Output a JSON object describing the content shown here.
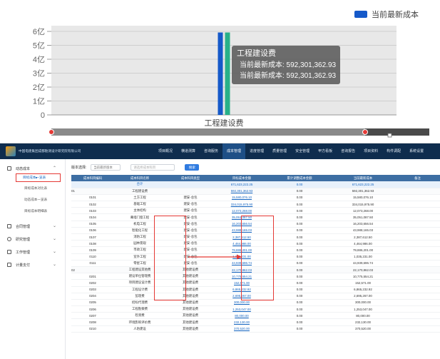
{
  "chart_data": {
    "type": "bar",
    "categories": [
      "工程建设费"
    ],
    "series": [
      {
        "name": "当前最新成本",
        "values": [
          5.92301362933
        ],
        "color": "#1559c9"
      },
      {
        "name": "当前最新成本",
        "values": [
          5.92301362933
        ],
        "color": "#27b089"
      }
    ],
    "ylim": [
      0,
      6
    ],
    "yticks": [
      "0",
      "1亿",
      "2亿",
      "3亿",
      "4亿",
      "5亿",
      "6亿"
    ],
    "legend": "top-right",
    "grid": true
  },
  "legend_label": "当前最新成本",
  "tooltip": {
    "title": "工程建设费",
    "rows": [
      {
        "label": "当前最新成本: 592,301,362.93",
        "color": "#1559c9"
      },
      {
        "label": "当前最新成本: 592,301,362.93",
        "color": "#27b089"
      }
    ]
  },
  "app": {
    "company": "中国电建集团成都勘测设计研究院有限公司",
    "nav": [
      "项目概况",
      "横道测算",
      "咨询服务",
      "成本管理",
      "进度管理",
      "质量管理",
      "安全管理",
      "甲方看板",
      "咨询报告",
      "项目资料",
      "构件调配",
      "系统设置"
    ],
    "active_nav": "成本管理",
    "sidebar": {
      "group1": "动态成本",
      "subs": [
        "目标成本一览表",
        "目标成本对比表",
        "动态成本一览表",
        "目标成本明细表"
      ],
      "groups": [
        "合同管理",
        "研究管理",
        "工作管理",
        "计量支付"
      ]
    },
    "filter_label": "版本选择:",
    "filter_value": "当前最新版本",
    "filter_placeholder": "请选择成本科目",
    "search_label": "搜索",
    "columns": [
      "成本科目编码",
      "成本科目名称",
      "成本科目类型",
      "目标成本金额",
      "累计调整成本金额",
      "当前最新成本",
      "备注"
    ],
    "rows": [
      {
        "code": "",
        "name": "合计",
        "type": "",
        "target": "671,623,222.25",
        "adj": "0.00",
        "latest": "671,623,222.25",
        "kind": "total"
      },
      {
        "code": "01",
        "name": "工程建设费",
        "type": "",
        "target": "592,301,362.93",
        "adj": "0.00",
        "latest": "592,301,362.93",
        "kind": "group"
      },
      {
        "code": "0101",
        "name": "土方工程",
        "type": "建安-总包",
        "target": "15,580,076.10",
        "adj": "0.00",
        "latest": "15,580,076.10",
        "kind": "row"
      },
      {
        "code": "0102",
        "name": "基础工程",
        "type": "建安-总包",
        "target": "334,015,975.90",
        "adj": "0.00",
        "latest": "334,015,975.90",
        "kind": "row"
      },
      {
        "code": "0103",
        "name": "主体结构",
        "type": "建安-总包",
        "target": "12,073,268.00",
        "adj": "0.00",
        "latest": "12,073,268.00",
        "kind": "row"
      },
      {
        "code": "0104",
        "name": "幕墙门窗工程",
        "type": "建安-总包",
        "target": "35,051,087.50",
        "adj": "0.00",
        "latest": "35,051,087.50",
        "kind": "row"
      },
      {
        "code": "0105",
        "name": "机电工程",
        "type": "建安-总包",
        "target": "16,203,656.54",
        "adj": "0.00",
        "latest": "16,203,656.54",
        "kind": "row"
      },
      {
        "code": "0106",
        "name": "智能化工程",
        "type": "建安-总包",
        "target": "43,988,165.03",
        "adj": "0.00",
        "latest": "43,988,165.03",
        "kind": "row"
      },
      {
        "code": "0107",
        "name": "消防工程",
        "type": "建安-总包",
        "target": "2,387,612.50",
        "adj": "0.00",
        "latest": "2,387,612.50",
        "kind": "row"
      },
      {
        "code": "0108",
        "name": "园林景观",
        "type": "建安-总包",
        "target": "4,464,986.00",
        "adj": "0.00",
        "latest": "4,464,986.00",
        "kind": "row"
      },
      {
        "code": "0109",
        "name": "市政工程",
        "type": "建安-总包",
        "target": "79,886,201.00",
        "adj": "0.00",
        "latest": "79,886,201.00",
        "kind": "row"
      },
      {
        "code": "0110",
        "name": "室外工程",
        "type": "建安-总包",
        "target": "1,035,231.00",
        "adj": "0.00",
        "latest": "1,035,231.00",
        "kind": "row"
      },
      {
        "code": "0111",
        "name": "零星工程",
        "type": "建安-总包",
        "target": "44,939,696.74",
        "adj": "0.00",
        "latest": "44,939,696.74",
        "kind": "row"
      },
      {
        "code": "02",
        "name": "工程建设其他费",
        "type": "其他建设费",
        "target": "22,170,862.03",
        "adj": "0.00",
        "latest": "22,170,862.03",
        "kind": "group"
      },
      {
        "code": "0201",
        "name": "建设单位管理费",
        "type": "其他建设费",
        "target": "10,775,554.21",
        "adj": "0.00",
        "latest": "10,775,554.21",
        "kind": "row"
      },
      {
        "code": "0202",
        "name": "项目建议设计费",
        "type": "其他建设费",
        "target": "152,571.00",
        "adj": "0.00",
        "latest": "152,571.00",
        "kind": "row"
      },
      {
        "code": "0203",
        "name": "工程设计费",
        "type": "其他建设费",
        "target": "6,865,232.92",
        "adj": "0.00",
        "latest": "6,865,232.92",
        "kind": "row"
      },
      {
        "code": "0204",
        "name": "监理费",
        "type": "其他建设费",
        "target": "2,695,267.00",
        "adj": "0.00",
        "latest": "2,695,267.00",
        "kind": "row"
      },
      {
        "code": "0205",
        "name": "招标代理费",
        "type": "其他建设费",
        "target": "300,000.00",
        "adj": "0.00",
        "latest": "300,000.00",
        "kind": "row"
      },
      {
        "code": "0206",
        "name": "工程勘察费",
        "type": "其他建设费",
        "target": "1,253,047.00",
        "adj": "0.00",
        "latest": "1,253,047.00",
        "kind": "row"
      },
      {
        "code": "0207",
        "name": "检测费",
        "type": "其他建设费",
        "target": "80,000.00",
        "adj": "0.00",
        "latest": "80,000.00",
        "kind": "row"
      },
      {
        "code": "0208",
        "name": "环境影响评价费",
        "type": "其他建设费",
        "target": "232,130.00",
        "adj": "0.00",
        "latest": "232,130.00",
        "kind": "row"
      },
      {
        "code": "0210",
        "name": "人防建设",
        "type": "其他建设费",
        "target": "370,520.00",
        "adj": "0.00",
        "latest": "370,520.00",
        "kind": "row"
      }
    ]
  }
}
